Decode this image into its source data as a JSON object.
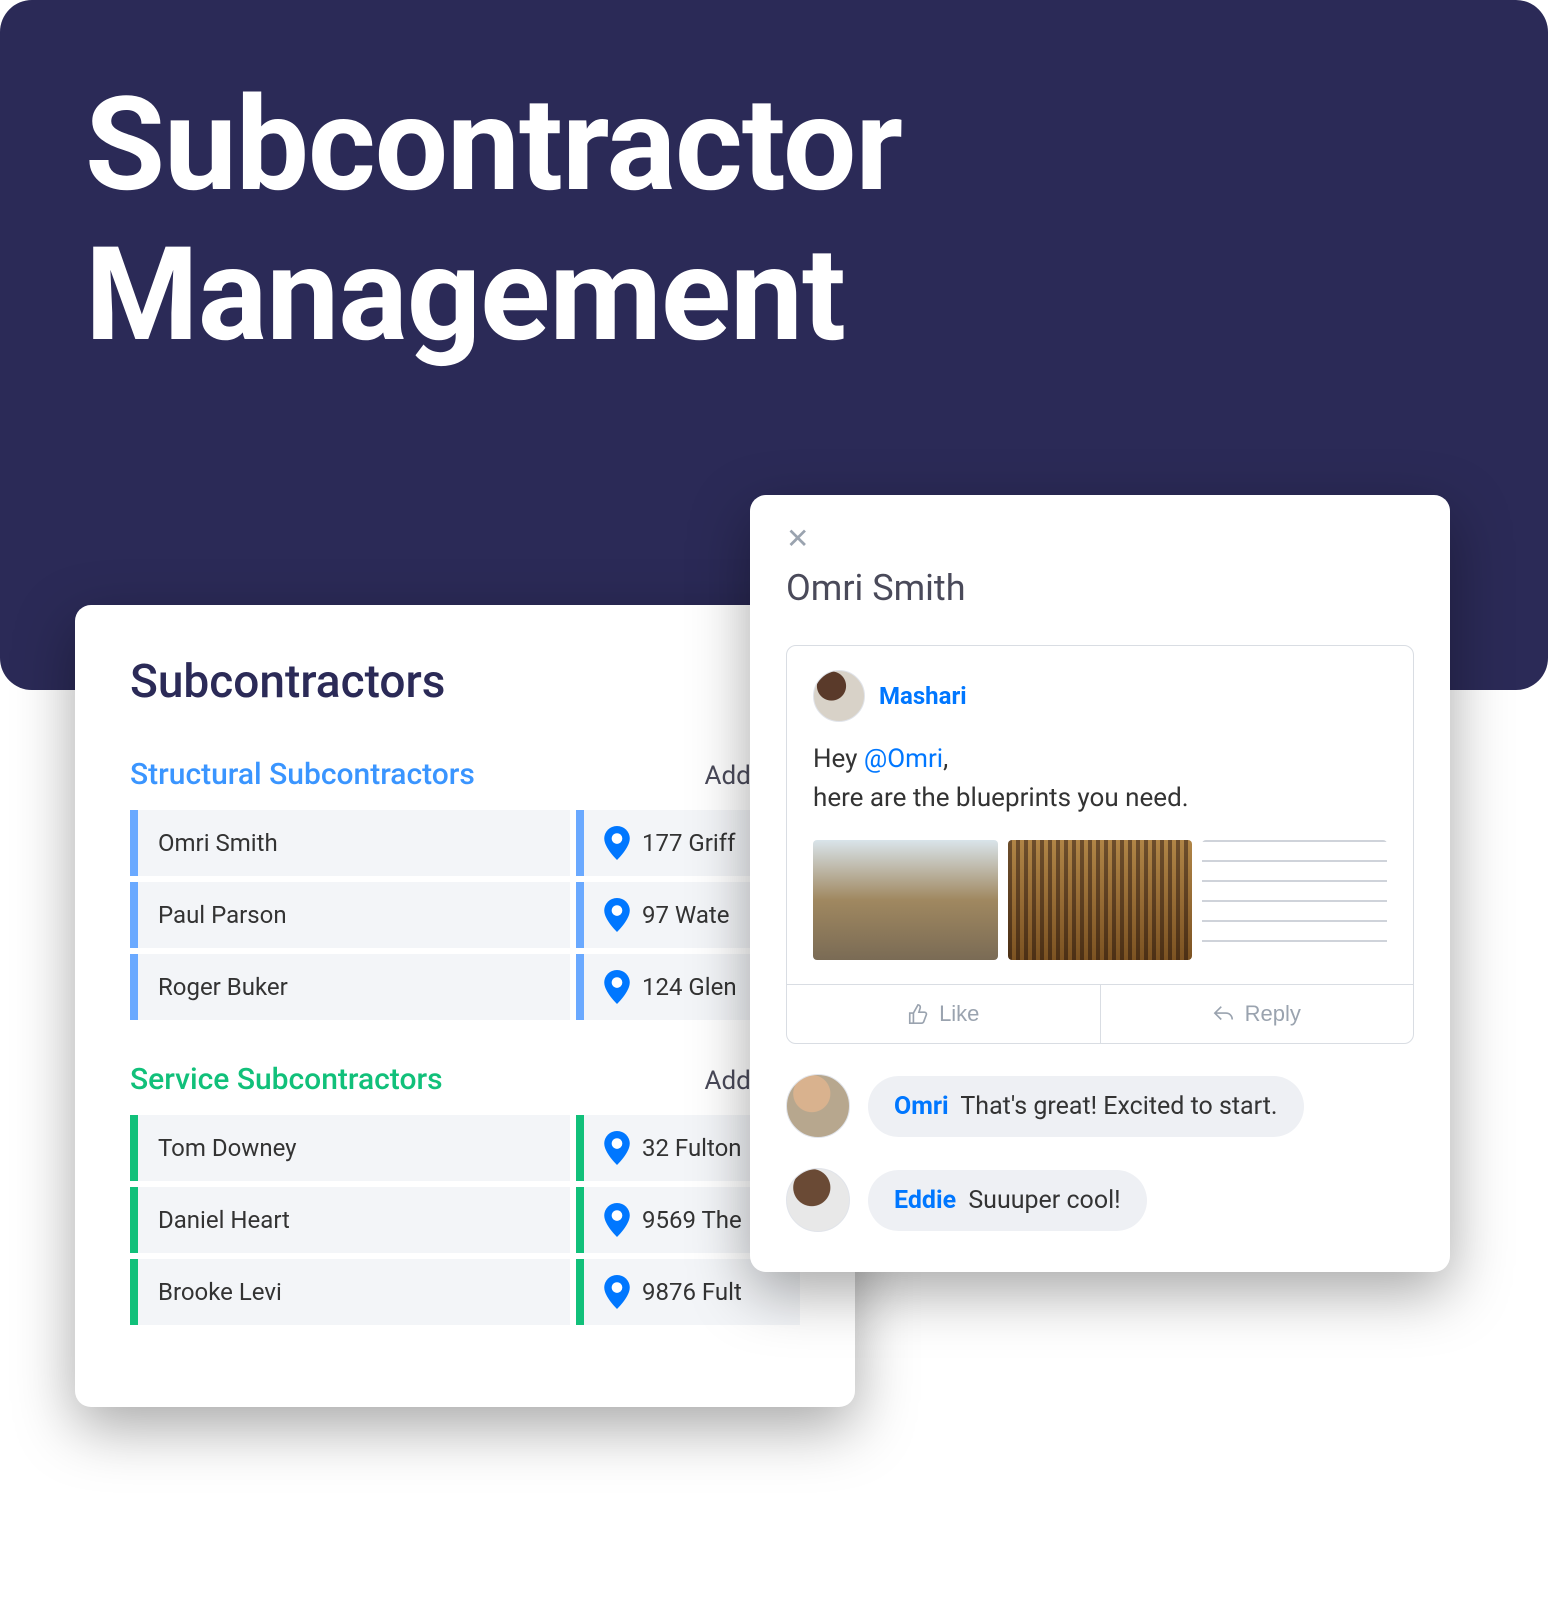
{
  "hero": {
    "title": "Subcontractor Management"
  },
  "list": {
    "title": "Subcontractors",
    "groups": [
      {
        "id": "structural",
        "title": "Structural Subcontractors",
        "address_header": "Address",
        "rows": [
          {
            "name": "Omri Smith",
            "address": "177 Griff"
          },
          {
            "name": "Paul Parson",
            "address": "97  Wate"
          },
          {
            "name": "Roger Buker",
            "address": "124 Glen"
          }
        ]
      },
      {
        "id": "service",
        "title": "Service Subcontractors",
        "address_header": "Address",
        "rows": [
          {
            "name": "Tom Downey",
            "address": "32 Fulton"
          },
          {
            "name": "Daniel Heart",
            "address": "9569 The"
          },
          {
            "name": "Brooke Levi",
            "address": "9876 Fult"
          }
        ]
      }
    ]
  },
  "chat": {
    "title": "Omri Smith",
    "post": {
      "author": "Mashari",
      "greeting": "Hey ",
      "mention": "@Omri",
      "after_mention": ",",
      "body_line2": "here are the blueprints you need."
    },
    "actions": {
      "like": "Like",
      "reply": "Reply"
    },
    "replies": [
      {
        "author": "Omri",
        "text": "That's great! Excited to start."
      },
      {
        "author": "Eddie",
        "text": "Suuuper cool!"
      }
    ]
  }
}
